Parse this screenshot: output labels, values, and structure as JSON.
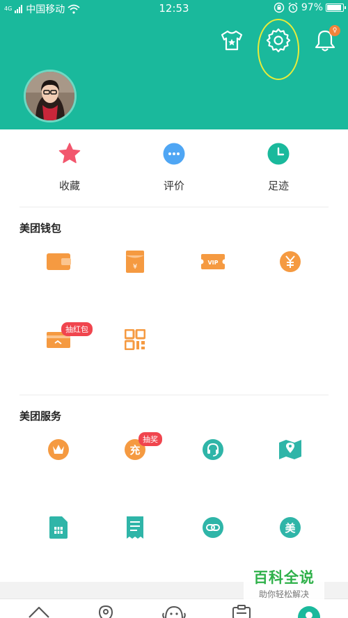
{
  "status_bar": {
    "signal_small": "4G",
    "carrier": "中国移动",
    "time": "12:53",
    "battery": "97%",
    "battery_level": 0.97
  },
  "header": {
    "icons": [
      "shirt-icon",
      "gear-icon",
      "bell-icon"
    ],
    "bell_badge": "♀",
    "bg_color": "#1ab99c"
  },
  "quick_row": [
    {
      "label": "收藏",
      "icon": "star-icon",
      "color": "#f2566d"
    },
    {
      "label": "评价",
      "icon": "comment-icon",
      "color": "#4fa6f4"
    },
    {
      "label": "足迹",
      "icon": "clock-icon",
      "color": "#1ab99c"
    }
  ],
  "wallet": {
    "title": "美团钱包",
    "items": [
      "wallet-icon",
      "red-packet-icon",
      "vip-card-icon",
      "yuan-coin-icon",
      "bank-card-icon",
      "qr-code-icon"
    ],
    "bank_card_tag": "抽红包",
    "accent_color": "#f59a41"
  },
  "services": {
    "title": "美团服务",
    "items": [
      "crown-icon",
      "recharge-icon",
      "headset-icon",
      "map-pin-icon",
      "sim-card-icon",
      "receipt-icon",
      "link-icon",
      "mei-icon"
    ],
    "recharge_label": "充",
    "recharge_tag": "抽奖",
    "mei_label": "美"
  },
  "bottom_nav": {
    "items": [
      "home-icon",
      "location-icon",
      "face-icon",
      "order-icon",
      "profile-icon"
    ]
  },
  "watermark": {
    "title": "百科全说",
    "subtitle": "助你轻松解决"
  }
}
